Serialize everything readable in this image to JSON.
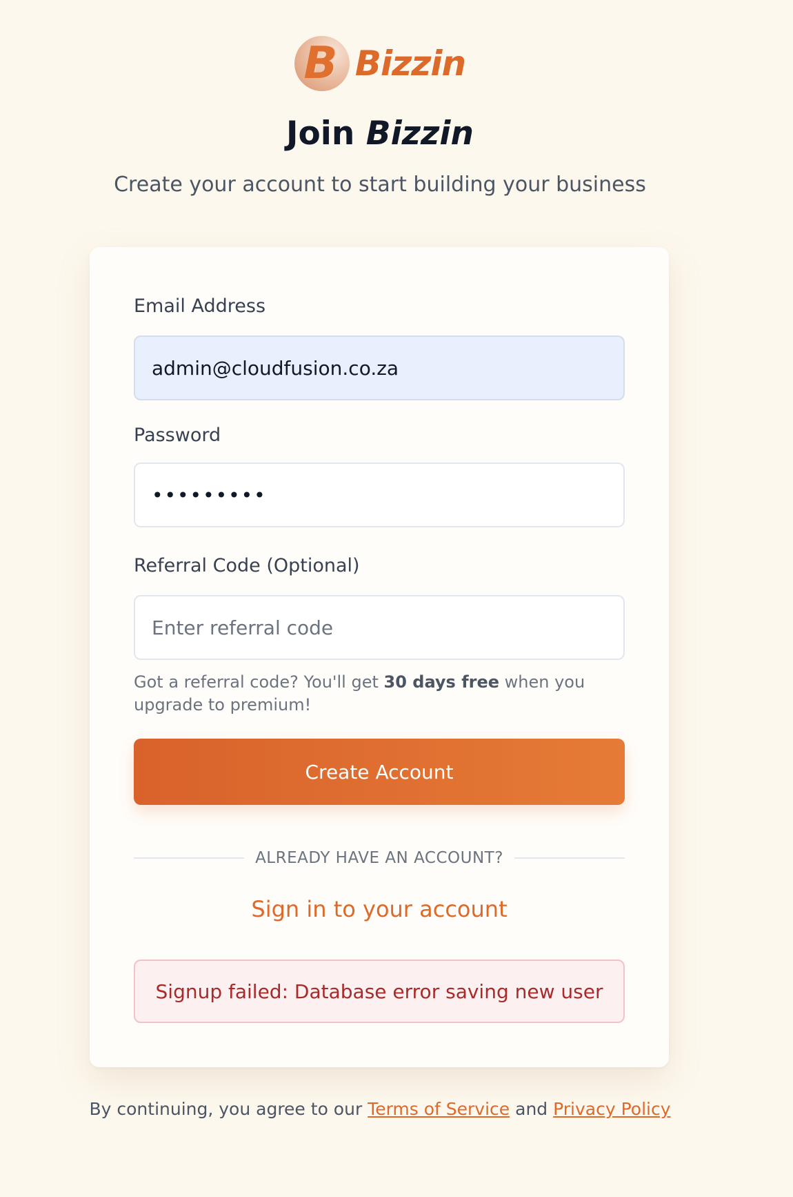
{
  "brand": {
    "name": "Bizzin",
    "logo_letter": "B",
    "accent_color": "#dc6a2b"
  },
  "header": {
    "title_prefix": "Join ",
    "title_emphasis": "Bizzin",
    "subtitle": "Create your account to start building your business"
  },
  "form": {
    "email": {
      "label": "Email Address",
      "value": "admin@cloudfusion.co.za"
    },
    "password": {
      "label": "Password",
      "value": "•••••••••"
    },
    "referral": {
      "label": "Referral Code (Optional)",
      "placeholder": "Enter referral code",
      "value": ""
    },
    "hint": {
      "before": "Got a referral code? You'll get ",
      "bold": "30 days free",
      "after": " when you upgrade to premium!"
    },
    "submit_label": "Create Account"
  },
  "divider_text": "ALREADY HAVE AN ACCOUNT?",
  "signin_link": "Sign in to your account",
  "error_message": "Signup failed: Database error saving new user",
  "footer": {
    "prefix": "By continuing, you agree to our ",
    "terms": "Terms of Service",
    "conjunction": " and ",
    "privacy": "Privacy Policy"
  }
}
